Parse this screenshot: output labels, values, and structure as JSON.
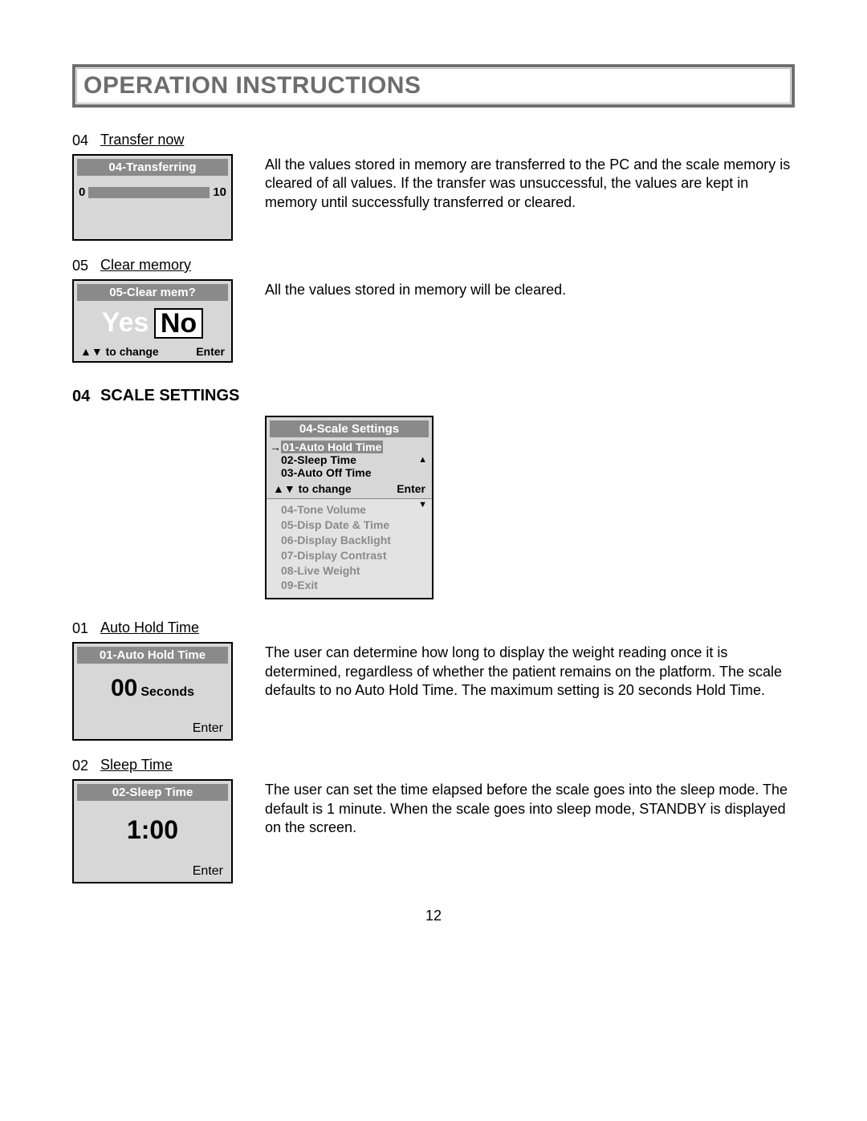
{
  "title": "OPERATION INSTRUCTIONS",
  "items": {
    "transfer": {
      "num": "04",
      "label": "Transfer now",
      "screen_title": "04-Transferring",
      "min": "0",
      "max": "10",
      "desc": "All the values stored in memory are transferred to the PC and the scale memory is cleared of all values. If the transfer was unsuccessful, the values are kept in memory until successfully transferred or cleared."
    },
    "clear": {
      "num": "05",
      "label": "Clear memory",
      "screen_title": "05-Clear mem?",
      "yes": "Yes",
      "no": "No",
      "change": "▲▼ to change",
      "enter": "Enter",
      "desc": "All the values stored in memory will be cleared."
    }
  },
  "section": {
    "num": "04",
    "label": "SCALE SETTINGS",
    "menu_title": "04-Scale Settings",
    "menu_visible": [
      "01-Auto Hold Time",
      "02-Sleep Time",
      "03-Auto Off Time"
    ],
    "menu_change": "▲▼ to change",
    "menu_enter": "Enter",
    "menu_hidden": [
      "04-Tone Volume",
      "05-Disp Date & Time",
      "06-Display Backlight",
      "07-Display Contrast",
      "08-Live Weight",
      "09-Exit"
    ]
  },
  "sub": {
    "autohold": {
      "num": "01",
      "label": "Auto Hold Time",
      "screen_title": "01-Auto Hold Time",
      "value": "00",
      "unit": "Seconds",
      "enter": "Enter",
      "desc": "The user can determine how long to display the weight reading once it is determined, regardless of whether the patient remains on the platform. The scale defaults to no Auto Hold Time. The maximum setting is 20 seconds Hold Time."
    },
    "sleep": {
      "num": "02",
      "label": "Sleep Time",
      "screen_title": "02-Sleep Time",
      "value": "1:00",
      "enter": "Enter",
      "desc": "The user can set the time elapsed before the scale goes into the sleep mode. The default is 1 minute. When the scale goes into sleep mode, STANDBY is displayed on the screen."
    }
  },
  "page": "12"
}
